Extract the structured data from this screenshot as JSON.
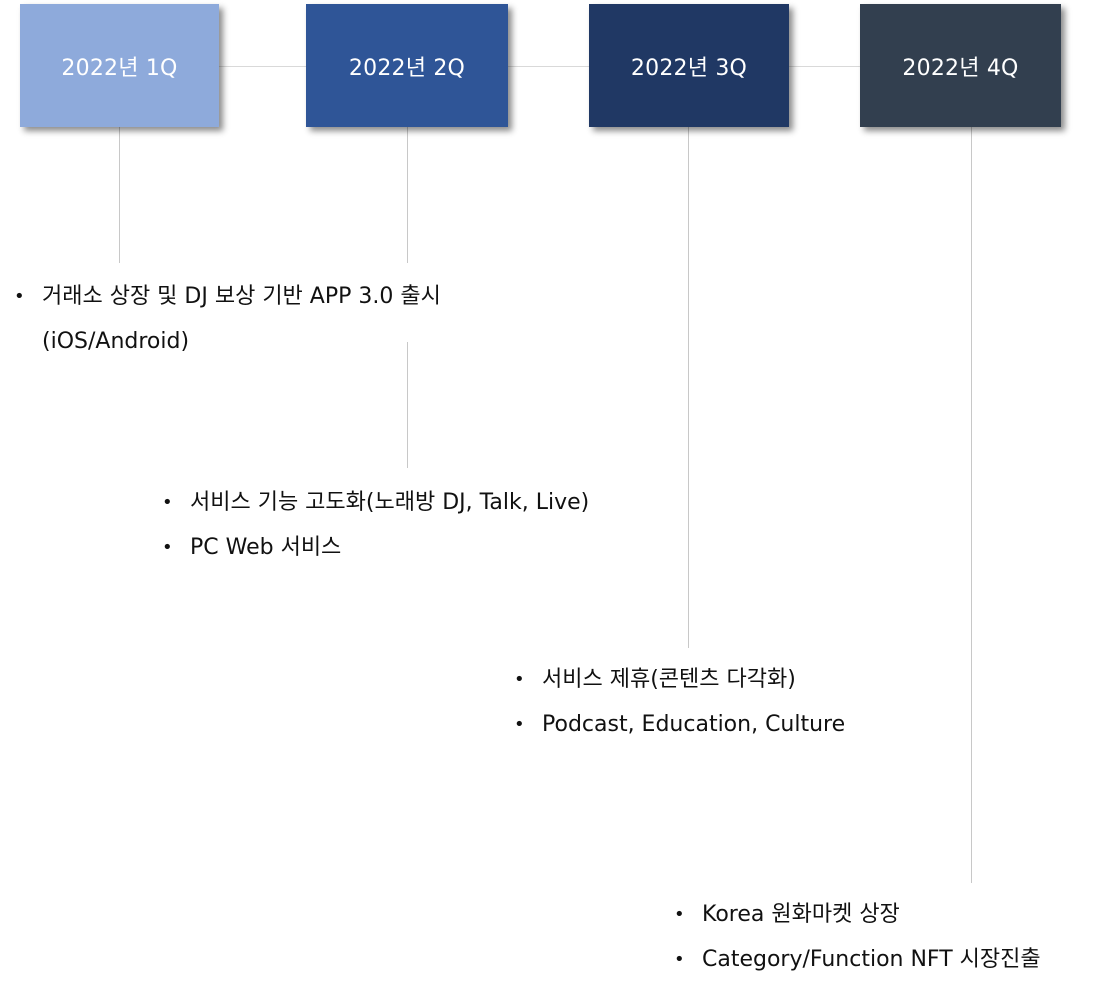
{
  "timeline": {
    "quarters": [
      {
        "label": "2022년 1Q",
        "color": "#8eaadb"
      },
      {
        "label": "2022년 2Q",
        "color": "#2f5597"
      },
      {
        "label": "2022년 3Q",
        "color": "#203864"
      },
      {
        "label": "2022년 4Q",
        "color": "#323f4f"
      }
    ]
  },
  "milestones": {
    "q1": [
      "거래소 상장 및 DJ 보상 기반 APP 3.0 출시",
      "(iOS/Android)"
    ],
    "q2": [
      "서비스 기능 고도화(노래방 DJ, Talk, Live)",
      "PC Web 서비스"
    ],
    "q3": [
      "서비스 제휴(콘텐츠 다각화)",
      "Podcast, Education, Culture"
    ],
    "q4": [
      "Korea 원화마켓 상장",
      "Category/Function NFT 시장진출"
    ]
  }
}
